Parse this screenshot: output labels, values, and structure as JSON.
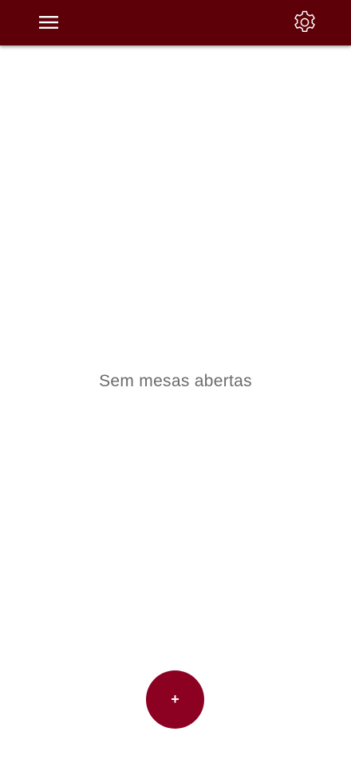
{
  "header": {
    "background_color": "#5e0008",
    "menu_icon": "hamburger-menu-icon",
    "settings_icon": "gear-icon"
  },
  "main": {
    "empty_state_text": "Sem mesas abertas"
  },
  "fab": {
    "label": "+",
    "color": "#8c0022"
  }
}
